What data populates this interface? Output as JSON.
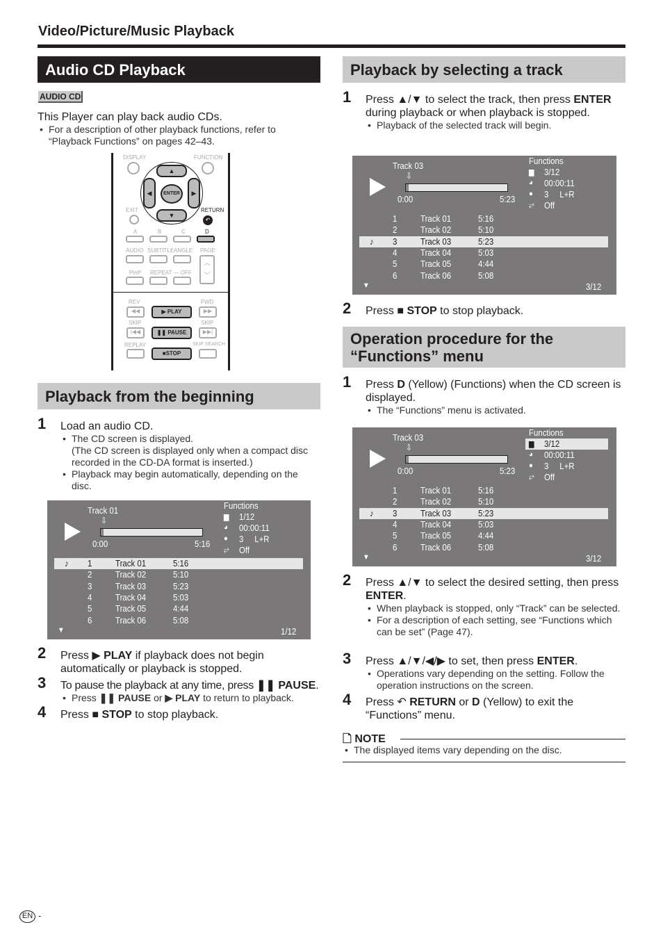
{
  "header": {
    "section": "Video/Picture/Music Playback"
  },
  "left": {
    "title": "Audio CD Playback",
    "badge": "AUDIO CD",
    "intro": "This Player can play back audio CDs.",
    "intro_bullet": "For a description of other playback functions, refer to “Playback Functions” on pages 42–43.",
    "remote": {
      "labels": {
        "display": "DISPLAY",
        "function": "FUNCTION",
        "enter": "ENTER",
        "exit": "EXIT",
        "return": "RETURN",
        "a": "A",
        "b": "B",
        "c": "C",
        "d": "D",
        "audio": "AUDIO",
        "subtitle": "SUBTITLE",
        "angle": "ANGLE",
        "page": "PAGE",
        "pinp": "PinP",
        "repeat": "REPEAT — OFF",
        "rev": "REV",
        "fwd": "FWD",
        "skip_l": "SKIP",
        "skip_r": "SKIP",
        "replay": "REPLAY",
        "skip_search": "SKIP SEARCH",
        "play": "▶ PLAY",
        "pause": "❚❚ PAUSE",
        "stop": "■STOP"
      }
    },
    "beginning": {
      "title": "Playback from the beginning",
      "step1": {
        "num": "1",
        "text": "Load an audio CD.",
        "bullets": [
          "The CD screen is displayed.",
          "Playback may begin automatically, depending on the disc."
        ],
        "subnote": "(The CD screen is displayed only when a compact disc recorded in the CD-DA format is inserted.)"
      },
      "step2": {
        "num": "2",
        "pre": "Press ▶ ",
        "bold": "PLAY",
        "post": " if playback does not begin automatically or playback is stopped."
      },
      "step3": {
        "num": "3",
        "pre": "To pause the playback at any time, press ",
        "bold": "❚❚ PAUSE",
        "post": ".",
        "bullet_pre": "Press ",
        "bullet_b1": "❚❚ PAUSE",
        "bullet_mid": " or ",
        "bullet_b2": "▶ PLAY",
        "bullet_post": " to return to playback."
      },
      "step4": {
        "num": "4",
        "pre": "Press ",
        "bold": "■ STOP",
        "post": " to stop playback."
      }
    }
  },
  "right": {
    "select": {
      "title": "Playback by selecting a track",
      "step1": {
        "num": "1",
        "pre": "Press ▲/▼ to select the track, then press ",
        "bold": "ENTER",
        "post": " during playback or when playback is stopped.",
        "bullet": "Playback of the selected track will begin."
      },
      "step2": {
        "num": "2",
        "pre": "Press ",
        "bold": "■ STOP",
        "post": " to stop playback."
      }
    },
    "functions": {
      "title": "Operation procedure for the “Functions” menu",
      "step1": {
        "num": "1",
        "pre": "Press ",
        "bold": "D",
        "post": " (Yellow) (Functions) when the CD screen is displayed.",
        "bullet": "The “Functions” menu is activated."
      },
      "step2": {
        "num": "2",
        "pre": "Press ▲/▼ to select the desired setting, then press ",
        "bold": "ENTER",
        "post": ".",
        "bullets": [
          "When playback is stopped, only “Track” can be selected.",
          "For a description of each setting, see “Functions which can be set” (Page 47)."
        ]
      },
      "step3": {
        "num": "3",
        "pre": "Press ▲/▼/◀/▶ to set, then press ",
        "bold": "ENTER",
        "post": ".",
        "bullet": "Operations vary depending on the setting. Follow the operation instructions on the screen."
      },
      "step4": {
        "num": "4",
        "pre": "Press ↶ ",
        "bold": "RETURN",
        "mid": " or ",
        "bold2": "D",
        "post": " (Yellow) to exit the “Functions” menu."
      }
    },
    "note": {
      "title": "NOTE",
      "text": "The displayed items vary depending on the disc."
    }
  },
  "screens": [
    {
      "track": "Track 01",
      "start": "0:00",
      "end": "5:16",
      "progress": 0.03,
      "functions_label": "Functions",
      "functions": [
        {
          "icon": "title-icon",
          "value": "1/12"
        },
        {
          "icon": "clock-icon",
          "value": "00:00:11"
        },
        {
          "icon": "audio-icon",
          "value": "3     L+R"
        },
        {
          "icon": "repeat-icon",
          "value": "Off"
        }
      ],
      "func_highlight": -1,
      "tracks": [
        [
          "1",
          "Track 01",
          "5:16"
        ],
        [
          "2",
          "Track 02",
          "5:10"
        ],
        [
          "3",
          "Track 03",
          "5:23"
        ],
        [
          "4",
          "Track 04",
          "5:03"
        ],
        [
          "5",
          "Track 05",
          "4:44"
        ],
        [
          "6",
          "Track 06",
          "5:08"
        ]
      ],
      "current": 0,
      "page": "1/12"
    },
    {
      "track": "Track 03",
      "start": "0:00",
      "end": "5:23",
      "progress": 0.03,
      "functions_label": "Functions",
      "functions": [
        {
          "icon": "title-icon",
          "value": "3/12"
        },
        {
          "icon": "clock-icon",
          "value": "00:00:11"
        },
        {
          "icon": "audio-icon",
          "value": "3     L+R"
        },
        {
          "icon": "repeat-icon",
          "value": "Off"
        }
      ],
      "func_highlight": -1,
      "tracks": [
        [
          "1",
          "Track 01",
          "5:16"
        ],
        [
          "2",
          "Track 02",
          "5:10"
        ],
        [
          "3",
          "Track 03",
          "5:23"
        ],
        [
          "4",
          "Track 04",
          "5:03"
        ],
        [
          "5",
          "Track 05",
          "4:44"
        ],
        [
          "6",
          "Track 06",
          "5:08"
        ]
      ],
      "current": 2,
      "page": "3/12"
    },
    {
      "track": "Track 03",
      "start": "0:00",
      "end": "5:23",
      "progress": 0.03,
      "functions_label": "Functions",
      "functions": [
        {
          "icon": "title-icon",
          "value": "3/12"
        },
        {
          "icon": "clock-icon",
          "value": "00:00:11"
        },
        {
          "icon": "audio-icon",
          "value": "3     L+R"
        },
        {
          "icon": "repeat-icon",
          "value": "Off"
        }
      ],
      "func_highlight": 0,
      "tracks": [
        [
          "1",
          "Track 01",
          "5:16"
        ],
        [
          "2",
          "Track 02",
          "5:10"
        ],
        [
          "3",
          "Track 03",
          "5:23"
        ],
        [
          "4",
          "Track 04",
          "5:03"
        ],
        [
          "5",
          "Track 05",
          "4:44"
        ],
        [
          "6",
          "Track 06",
          "5:08"
        ]
      ],
      "current": 2,
      "page": "3/12"
    }
  ],
  "footer": {
    "lang": "EN",
    "dash": "-"
  }
}
